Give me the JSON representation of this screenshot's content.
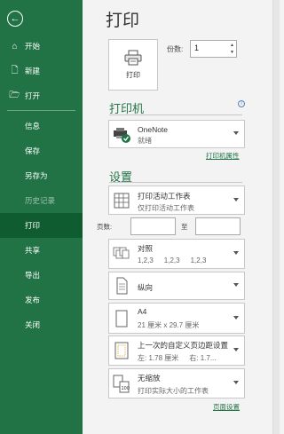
{
  "sidebar": {
    "back": "←",
    "items_top": [
      {
        "label": "开始",
        "icon": "home-icon"
      },
      {
        "label": "新建",
        "icon": "new-file-icon"
      },
      {
        "label": "打开",
        "icon": "open-folder-icon"
      }
    ],
    "items_bottom": [
      {
        "label": "信息"
      },
      {
        "label": "保存"
      },
      {
        "label": "另存为"
      },
      {
        "label": "历史记录",
        "disabled": true
      },
      {
        "label": "打印",
        "selected": true
      },
      {
        "label": "共享"
      },
      {
        "label": "导出"
      },
      {
        "label": "发布"
      },
      {
        "label": "关闭"
      }
    ]
  },
  "main": {
    "title": "打印",
    "print_button": "打印",
    "copies_label": "份数:",
    "copies_value": "1",
    "printer_section": "打印机",
    "printer_name": "OneNote",
    "printer_status": "就绪",
    "printer_props": "打印机属性",
    "settings_section": "设置",
    "scope": {
      "title": "打印活动工作表",
      "sub": "仅打印活动工作表"
    },
    "pages_label": "页数:",
    "pages_to": "至",
    "collate": {
      "title": "对照",
      "sub": [
        "1,2,3",
        "1,2,3",
        "1,2,3"
      ]
    },
    "orientation": {
      "title": "纵向"
    },
    "paper": {
      "title": "A4",
      "sub": "21 厘米 x 29.7 厘米"
    },
    "margins": {
      "title": "上一次的自定义页边距设置",
      "sub_left": "左: 1.78 厘米",
      "sub_right": "右: 1.7..."
    },
    "scaling": {
      "title": "无缩放",
      "sub": "打印实际大小的工作表"
    },
    "page_setup": "页面设置"
  },
  "colors": {
    "accent": "#217346",
    "selected": "#0e5c2f"
  }
}
